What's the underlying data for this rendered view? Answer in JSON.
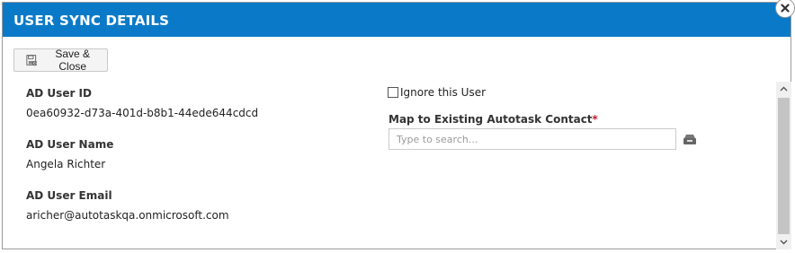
{
  "dialog": {
    "title": "USER SYNC DETAILS",
    "close_icon": "close-icon"
  },
  "toolbar": {
    "save_close_label": "Save & Close",
    "save_icon": "save-icon"
  },
  "fields": {
    "ad_user_id_label": "AD User ID",
    "ad_user_id_value": "0ea60932-d73a-401d-b8b1-44ede644cdcd",
    "ad_user_name_label": "AD User Name",
    "ad_user_name_value": "Angela Richter",
    "ad_user_email_label": "AD User Email",
    "ad_user_email_value": "aricher@autotaskqa.onmicrosoft.com"
  },
  "options": {
    "ignore_user_label": "Ignore this User",
    "ignore_user_checked": false
  },
  "mapping": {
    "label": "Map to Existing Autotask Contact",
    "required_marker": "*",
    "search_placeholder": "Type to search...",
    "search_value": "",
    "lookup_icon": "lookup-icon"
  },
  "colors": {
    "titlebar": "#0a7ac8",
    "required": "#c0202f"
  }
}
